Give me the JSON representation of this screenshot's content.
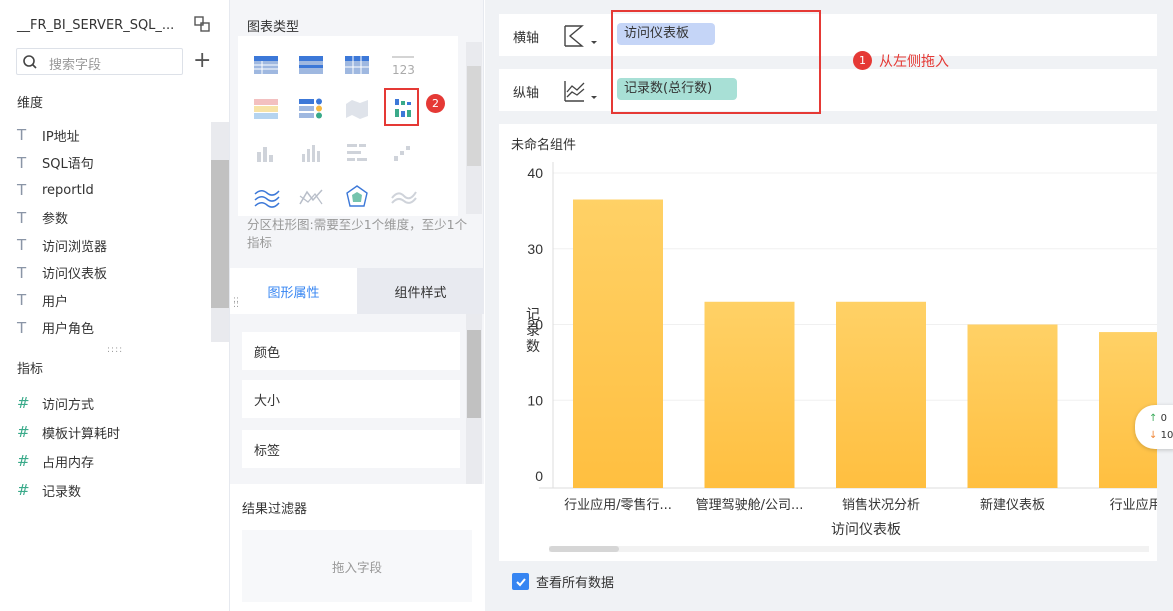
{
  "left": {
    "dataset_name": "__FR_BI_SERVER_SQL_...",
    "search_placeholder": "搜索字段",
    "dimensions_title": "维度",
    "dimensions": [
      "IP地址",
      "SQL语句",
      "reportId",
      "参数",
      "访问浏览器",
      "访问仪表板",
      "用户",
      "用户角色"
    ],
    "metrics_title": "指标",
    "metrics": [
      "访问方式",
      "模板计算耗时",
      "占用内存",
      "记录数"
    ]
  },
  "middle": {
    "chart_type_title": "图表类型",
    "chart_desc": "分区柱形图:需要至少1个维度，至少1个指标",
    "tab_graph": "图形属性",
    "tab_style": "组件样式",
    "props": [
      "颜色",
      "大小",
      "标签"
    ],
    "filter_title": "结果过滤器",
    "drop_hint": "拖入字段",
    "badge2": "2"
  },
  "right": {
    "x_axis_label": "横轴",
    "x_axis_field": "访问仪表板",
    "y_axis_label": "纵轴",
    "y_axis_field": "记录数(总行数)",
    "badge1": "1",
    "annotation": "从左侧拖入",
    "widget_title": "未命名组件",
    "view_all": "查看所有数据",
    "tip_up": "0",
    "tip_down": "10",
    "colors": {
      "accent": "#3685f2",
      "bar": "#ffc44d",
      "red": "#e53935",
      "x_pill": "#c5d5f7",
      "y_pill": "#a8e0d6"
    }
  },
  "chart_data": {
    "type": "bar",
    "categories": [
      "行业应用/零售行...",
      "管理驾驶舱/公司...",
      "销售状况分析",
      "新建仪表板",
      "行业应用/..."
    ],
    "values": [
      36.5,
      23,
      23,
      20,
      19
    ],
    "xlabel": "访问仪表板",
    "ylabel": "记录数",
    "ylim": [
      0,
      40
    ],
    "yticks": [
      0,
      10,
      20,
      30,
      40
    ],
    "grid": true
  }
}
